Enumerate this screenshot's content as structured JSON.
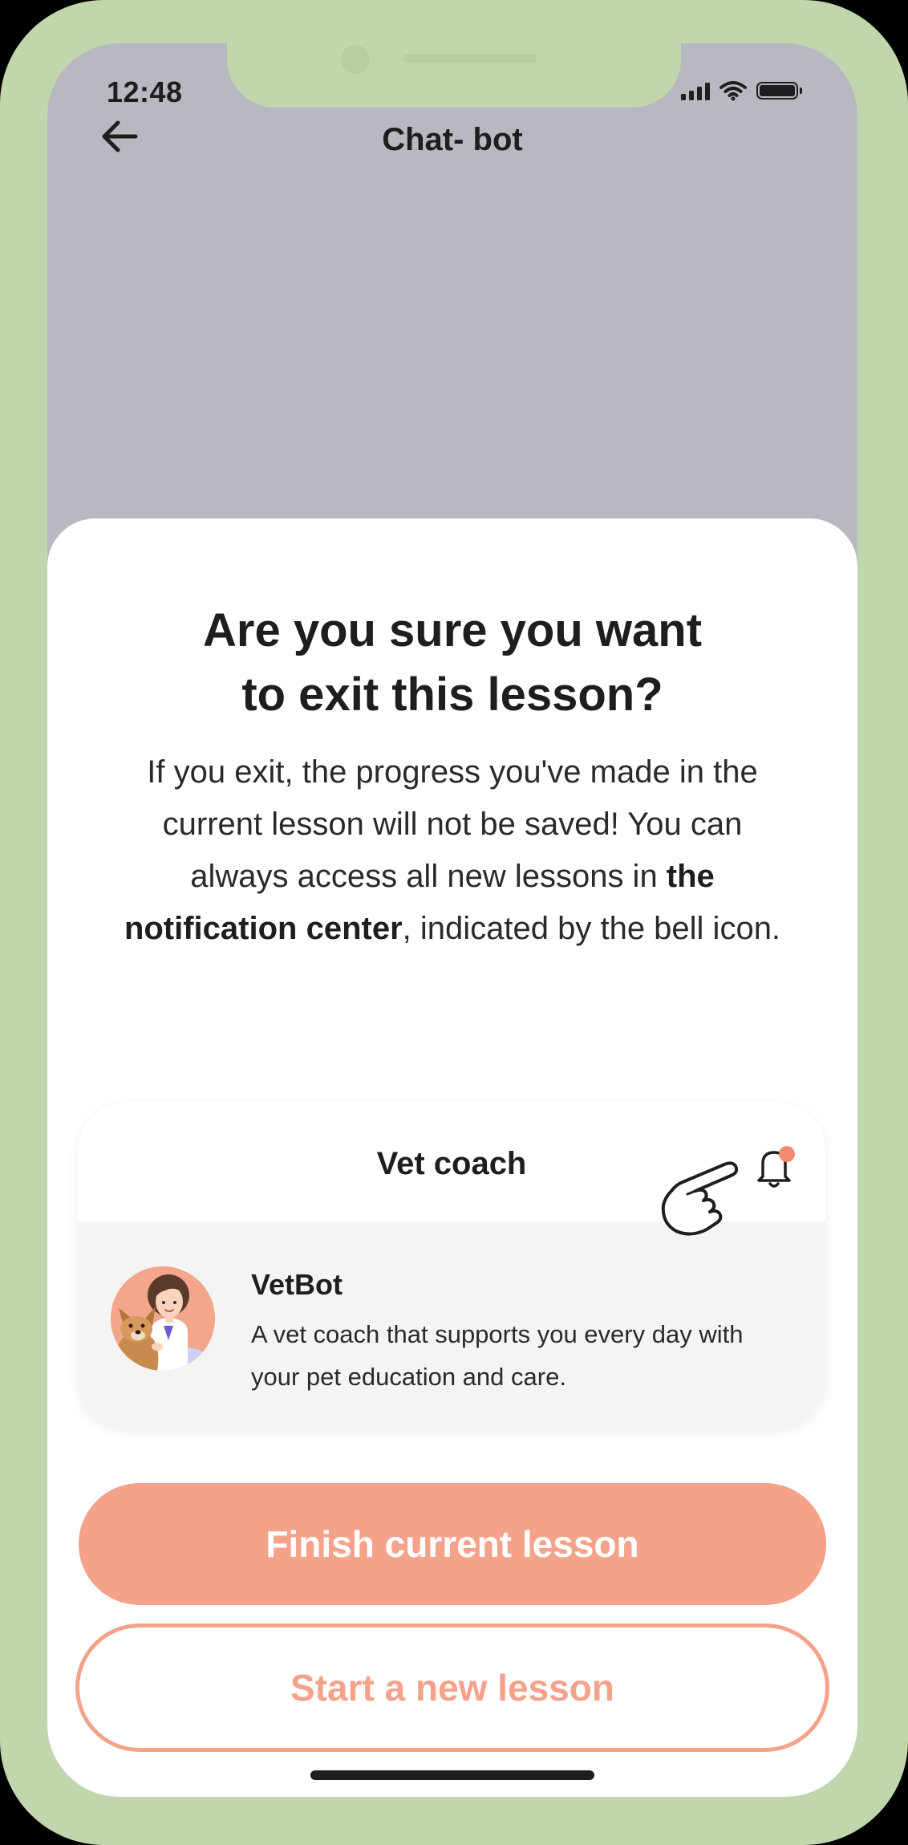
{
  "status_bar": {
    "time": "12:48"
  },
  "header": {
    "title": "Chat- bot"
  },
  "dialog": {
    "title": "Are you sure you want\nto exit this lesson?",
    "body_part1": "If you exit, the progress you've made in the current lesson will not be saved! You can always access all new lessons in ",
    "body_bold": "the notification center",
    "body_part2": ", indicated by the bell icon."
  },
  "card": {
    "title": "Vet coach",
    "bot_name": "VetBot",
    "bot_description": "A vet coach that supports you every day with your pet education and care."
  },
  "buttons": {
    "primary_label": "Finish current lesson",
    "secondary_label": "Start a new lesson"
  },
  "colors": {
    "frame": "#c2d6ad",
    "overlay": "#b8b8c1",
    "accent": "#f4a28a",
    "badge": "#f28a72"
  },
  "icons": {
    "back": "arrow-left-icon",
    "bell": "bell-icon",
    "pointer": "pointing-hand-icon",
    "signal": "signal-icon",
    "wifi": "wifi-icon",
    "battery": "battery-icon"
  }
}
